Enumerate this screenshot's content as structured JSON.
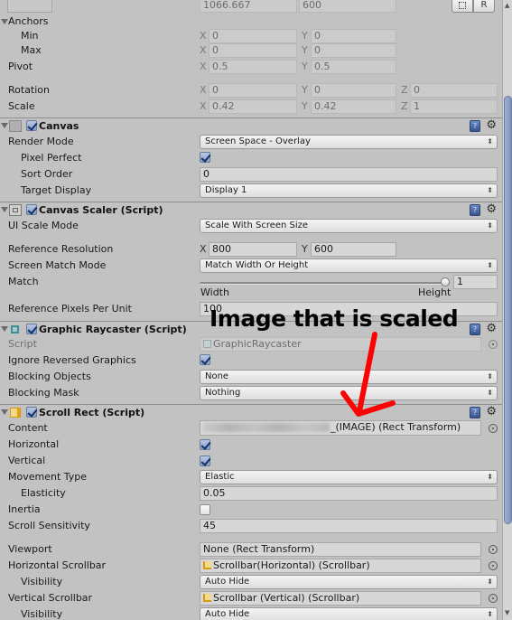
{
  "rect_transform": {
    "width_value": "1066.667",
    "height_value": "600",
    "blueprint_button": "",
    "raw_button": "R",
    "anchors_label": "Anchors",
    "min_label": "Min",
    "min": {
      "x_axis": "X",
      "x": "0",
      "y_axis": "Y",
      "y": "0"
    },
    "max_label": "Max",
    "max": {
      "x_axis": "X",
      "x": "0",
      "y_axis": "Y",
      "y": "0"
    },
    "pivot_label": "Pivot",
    "pivot": {
      "x_axis": "X",
      "x": "0.5",
      "y_axis": "Y",
      "y": "0.5"
    },
    "rotation_label": "Rotation",
    "rotation": {
      "x_axis": "X",
      "x": "0",
      "y_axis": "Y",
      "y": "0",
      "z_axis": "Z",
      "z": "0"
    },
    "scale_label": "Scale",
    "scale": {
      "x_axis": "X",
      "x": "0.42",
      "y_axis": "Y",
      "y": "0.42",
      "z_axis": "Z",
      "z": "1"
    }
  },
  "canvas": {
    "title": "Canvas",
    "enabled": true,
    "render_mode_label": "Render Mode",
    "render_mode": "Screen Space - Overlay",
    "pixel_perfect_label": "Pixel Perfect",
    "pixel_perfect": true,
    "sort_order_label": "Sort Order",
    "sort_order": "0",
    "target_display_label": "Target Display",
    "target_display": "Display 1"
  },
  "canvas_scaler": {
    "title": "Canvas Scaler (Script)",
    "enabled": true,
    "ui_scale_mode_label": "UI Scale Mode",
    "ui_scale_mode": "Scale With Screen Size",
    "reference_resolution_label": "Reference Resolution",
    "reference_resolution": {
      "x_axis": "X",
      "x": "800",
      "y_axis": "Y",
      "y": "600"
    },
    "screen_match_mode_label": "Screen Match Mode",
    "screen_match_mode": "Match Width Or Height",
    "match_label": "Match",
    "match_value": "1",
    "match_fraction": 1.0,
    "match_left_label": "Width",
    "match_right_label": "Height",
    "ref_pixels_label": "Reference Pixels Per Unit",
    "ref_pixels": "100"
  },
  "graphic_raycaster": {
    "title": "Graphic Raycaster (Script)",
    "enabled": true,
    "script_label": "Script",
    "script_value": "GraphicRaycaster",
    "ignore_reversed_label": "Ignore Reversed Graphics",
    "ignore_reversed": true,
    "blocking_objects_label": "Blocking Objects",
    "blocking_objects": "None",
    "blocking_mask_label": "Blocking Mask",
    "blocking_mask": "Nothing"
  },
  "scroll_rect": {
    "title": "Scroll Rect (Script)",
    "enabled": true,
    "content_label": "Content",
    "content_value_suffix": "_(IMAGE) (Rect Transform)",
    "horizontal_label": "Horizontal",
    "horizontal": true,
    "vertical_label": "Vertical",
    "vertical": true,
    "movement_type_label": "Movement Type",
    "movement_type": "Elastic",
    "elasticity_label": "Elasticity",
    "elasticity": "0.05",
    "inertia_label": "Inertia",
    "inertia": false,
    "scroll_sensitivity_label": "Scroll Sensitivity",
    "scroll_sensitivity": "45",
    "viewport_label": "Viewport",
    "viewport": "None (Rect Transform)",
    "horizontal_scrollbar_label": "Horizontal Scrollbar",
    "horizontal_scrollbar": "Scrollbar(Horizontal) (Scrollbar)",
    "h_visibility_label": "Visibility",
    "h_visibility": "Auto Hide",
    "vertical_scrollbar_label": "Vertical Scrollbar",
    "vertical_scrollbar": "Scrollbar (Vertical) (Scrollbar)",
    "v_visibility_label": "Visibility",
    "v_visibility": "Auto Hide"
  },
  "annotation": {
    "text": "Image that is scaled",
    "arrow_color": "#ff0000"
  },
  "icons": {
    "help": "?",
    "gear": "⚙",
    "dropdown_arrows": "⬍",
    "scroll_up": "▲",
    "scroll_down": "▼"
  },
  "colors": {
    "background": "#c2c2c2",
    "checkbox_accent": "#8aa0c8",
    "scroll_thumb": "#7f93ba"
  }
}
